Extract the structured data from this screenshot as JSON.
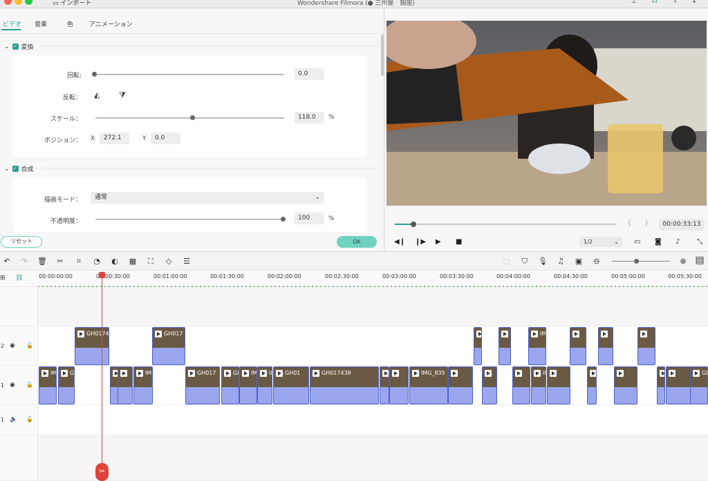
{
  "window": {
    "title": "Wondershare Filmora (● 三州屋　銀座)",
    "import_label": "インポート"
  },
  "tabs": [
    "ビデオ",
    "音楽",
    "色",
    "アニメーション"
  ],
  "transform": {
    "section_label": "変換",
    "rotate_label": "回転:",
    "rotate_value": "0.0",
    "flip_label": "反転：",
    "scale_label": "スケール：",
    "scale_value": "118.0",
    "scale_unit": "%",
    "position_label": "ポジション：",
    "x_label": "X",
    "x_value": "272.1",
    "y_label": "Y",
    "y_value": "0.0"
  },
  "composite": {
    "section_label": "合成",
    "blend_label": "描画モード：",
    "blend_value": "通常",
    "opacity_label": "不透明度：",
    "opacity_value": "100",
    "opacity_unit": "%"
  },
  "buttons": {
    "reset": "リセット",
    "ok": "OK"
  },
  "player": {
    "timecode": "00:00:33:13",
    "quality": "1/2",
    "mark_in": "{",
    "mark_out": "}",
    "progress": 0.08
  },
  "ruler": [
    "00:00:00:00",
    "00:00:30:00",
    "00:01:00:00",
    "00:01:30:00",
    "00:02:00:00",
    "00:02:30:00",
    "00:03:00:00",
    "00:03:30:00",
    "00:04:00:00",
    "00:04:30:00",
    "00:05:00:00",
    "00:05:30:00"
  ],
  "tracks": {
    "v2": "2",
    "v1": "1",
    "a1": "1"
  },
  "clips_v2": [
    "GH0174",
    "GH017",
    "",
    "",
    "IM",
    "",
    "",
    "",
    ""
  ],
  "clips_v1": [
    "IM",
    "GH",
    "",
    "",
    "IM",
    "GH017",
    "GI",
    "IM",
    "IM",
    "GH01",
    "GH017438",
    "",
    "",
    "IMG_835",
    "",
    "",
    "",
    "IM",
    "",
    "GH0",
    "",
    "",
    "",
    "GH0",
    ""
  ],
  "colors": {
    "accent": "#2a9d8f",
    "ok_button": "#6fd3c0",
    "clip": "#7f8fe0",
    "playhead": "#e0433b"
  },
  "icons": [
    "undo-icon",
    "redo-icon",
    "trash-icon",
    "cut-icon",
    "crop-icon",
    "speed-icon",
    "color-icon",
    "mosaic-icon",
    "fullscreen-icon",
    "keyframe-icon",
    "adjust-icon"
  ]
}
